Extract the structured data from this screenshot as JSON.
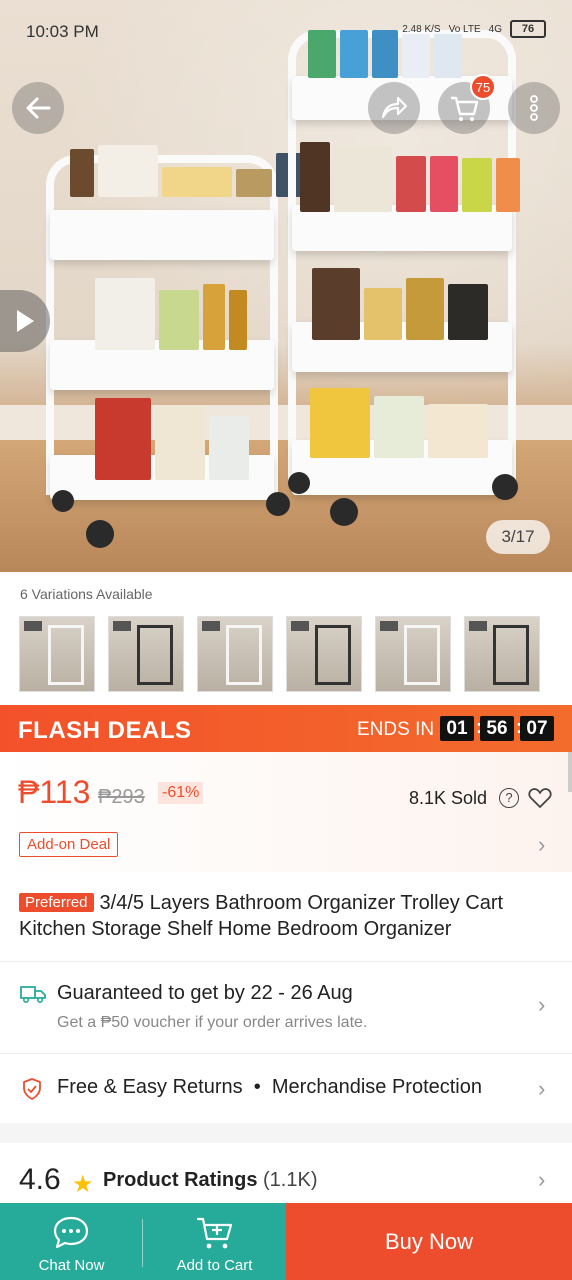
{
  "status_bar": {
    "time": "10:03 PM",
    "speed": "2.48",
    "speed_unit": "K/S",
    "network": "Vo LTE",
    "signal": "4G",
    "battery": "76"
  },
  "hero": {
    "cart_badge": "75",
    "image_counter": "3/17",
    "icons": [
      "back-arrow-icon",
      "share-icon",
      "cart-icon",
      "more-icon",
      "play-icon"
    ]
  },
  "variations": {
    "label": "6 Variations Available",
    "count": 6
  },
  "flash": {
    "title": "FLASH DEALS",
    "ends_label": "ENDS IN",
    "hours": "01",
    "minutes": "56",
    "seconds": "07"
  },
  "price": {
    "current": "₱113",
    "original": "₱293",
    "discount": "-61%",
    "sold": "8.1K Sold",
    "addon_label": "Add-on Deal"
  },
  "product": {
    "badge": "Preferred",
    "title": "3/4/5 Layers Bathroom Organizer Trolley Cart Kitchen Storage Shelf Home Bedroom Organizer"
  },
  "shipping": {
    "title": "Guaranteed to get by 22 - 26 Aug",
    "subtitle": "Get a ₱50 voucher if your order arrives late."
  },
  "returns": {
    "text1": "Free & Easy Returns",
    "separator": "•",
    "text2": "Merchandise Protection"
  },
  "ratings": {
    "score": "4.6",
    "label": "Product Ratings",
    "count": "(1.1K)"
  },
  "bottom_bar": {
    "chat_label": "Chat Now",
    "cart_label": "Add to Cart",
    "buy_label": "Buy Now"
  },
  "colors": {
    "brand": "#ee4d2d",
    "teal": "#26aa99",
    "star": "#ffc107"
  }
}
